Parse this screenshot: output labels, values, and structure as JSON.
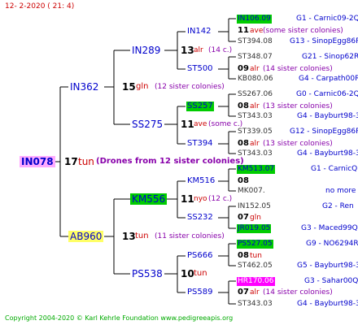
{
  "date": "12-  2-2020 ( 21:  4)",
  "root": {
    "id": "IN078",
    "gen": "17",
    "race": "tun",
    "desc": "(Drones from 12 sister colonies)"
  },
  "g1": [
    {
      "id": "IN362",
      "gen": "15",
      "race": "gln",
      "desc": "(12 sister colonies)"
    },
    {
      "id": "AB960",
      "gen": "13",
      "race": "tun",
      "desc": "(11 sister colonies)"
    }
  ],
  "g2": [
    {
      "id": "IN289",
      "gen": "13",
      "race": "alr",
      "desc": "(14 c.)"
    },
    {
      "id": "SS275",
      "gen": "11",
      "race": "ave",
      "desc": "(some c.)"
    },
    {
      "id": "KM556",
      "gen": "11",
      "race": "nyo",
      "desc": "(12 c.)"
    },
    {
      "id": "PS538",
      "gen": "10",
      "race": "tun",
      "desc": ""
    }
  ],
  "g3": [
    {
      "id": "IN142",
      "gen": "11",
      "race": "ave",
      "desc": "(some sister colonies)"
    },
    {
      "id": "ST500",
      "gen": "09",
      "race": "alr",
      "desc": "(14 sister colonies)"
    },
    {
      "id": "SS257",
      "gen": "08",
      "race": "alr",
      "desc": "(13 sister colonies)"
    },
    {
      "id": "ST394",
      "gen": "08",
      "race": "alr",
      "desc": "(13 sister colonies)"
    },
    {
      "id": "KM516",
      "gen": "08",
      "race": "",
      "desc": ""
    },
    {
      "id": "SS232",
      "gen": "07",
      "race": "gln",
      "desc": ""
    },
    {
      "id": "PS666",
      "gen": "08",
      "race": "tun",
      "desc": ""
    },
    {
      "id": "PS589",
      "gen": "07",
      "race": "alr",
      "desc": "(14 sister colonies)"
    }
  ],
  "g4": [
    {
      "id": "IN106.09",
      "ref": "G1 - Carnic09-2Q"
    },
    {
      "id": "ST394.08",
      "ref": "G13 - SinopEgg86R"
    },
    {
      "id": "ST348.07",
      "ref": "G21 - Sinop62R"
    },
    {
      "id": "KB080.06",
      "ref": "G4 - Carpath00R"
    },
    {
      "id": "SS267.06",
      "ref": "G0 - Carnic06-2Q"
    },
    {
      "id": "ST343.03",
      "ref": "G4 - Bayburt98-3"
    },
    {
      "id": "ST339.05",
      "ref": "G12 - SinopEgg86R"
    },
    {
      "id": "ST343.03",
      "ref": "G4 - Bayburt98-3"
    },
    {
      "id": "KM513.07",
      "ref": "G1 - CarnicQ"
    },
    {
      "id": "MK007.",
      "ref": "no more"
    },
    {
      "id": "IN152.05",
      "ref": "G2 - Ren"
    },
    {
      "id": "JR019.05",
      "ref": "G3 - Maced99Q"
    },
    {
      "id": "PS527.05",
      "ref": "G9 - NO6294R"
    },
    {
      "id": "ST462.05",
      "ref": "G5 - Bayburt98-3"
    },
    {
      "id": "HR170.06",
      "ref": "G3 - Sahar00Q"
    },
    {
      "id": "ST343.03",
      "ref": "G4 - Bayburt98-3"
    }
  ],
  "footer": "Copyright 2004-2020 © Karl Kehrle Foundation    www.pedigreeapis.org"
}
